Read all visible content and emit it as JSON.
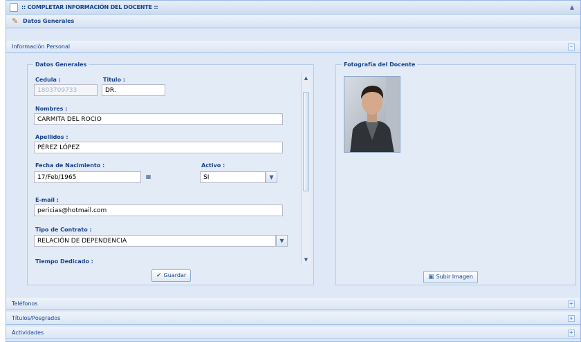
{
  "window": {
    "title": ":: COMPLETAR INFORMACIÓN DEL DOCENTE ::",
    "subtitle": "Datos Generales"
  },
  "section_personal": {
    "label": "Información Personal"
  },
  "datos_generales": {
    "legend": "Datos Generales",
    "cedula_label": "Cedula :",
    "cedula_value": "1803709733",
    "titulo_label": "Titulo :",
    "titulo_value": "DR.",
    "nombres_label": "Nombres :",
    "nombres_value": "CARMITA DEL ROCIO",
    "apellidos_label": "Apellidos :",
    "apellidos_value": "PÉREZ LÓPEZ",
    "fecha_label": "Fecha de Nacimiento :",
    "fecha_value": "17/Feb/1965",
    "activo_label": "Activo :",
    "activo_value": "SI",
    "email_label": "E-mail :",
    "email_value": "pericias@hotmail.com",
    "contrato_label": "Tipo de Contrato :",
    "contrato_value": "RELACIÓN DE DEPENDENCIA",
    "tiempo_label": "Tiempo Dedicado :",
    "save_label": "Guardar"
  },
  "foto": {
    "legend": "Fotografía del Docente",
    "upload_label": "Subir Imagen"
  },
  "accordion": {
    "telefonos": "Teléfonos",
    "titulos": "Títulos/Posgrados",
    "actividades": "Actividades"
  }
}
